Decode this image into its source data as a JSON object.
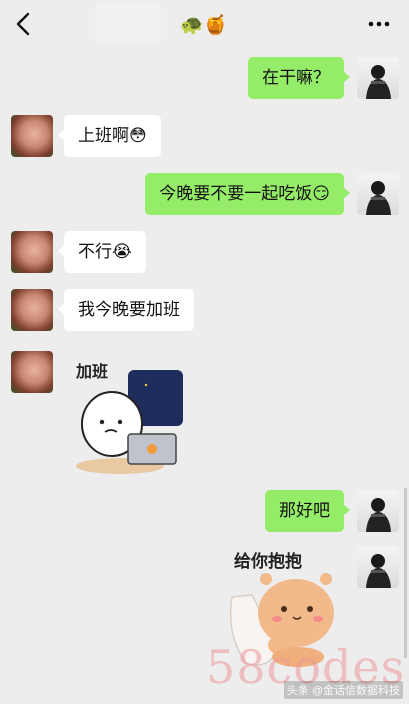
{
  "header": {
    "back_icon": "chevron-left-icon",
    "title_emoji": "🐢🍯",
    "more_icon": "more-dots-icon"
  },
  "messages": [
    {
      "side": "right",
      "type": "text",
      "text": "在干嘛？"
    },
    {
      "side": "left",
      "type": "text",
      "text": "上班啊",
      "emoji": "😳"
    },
    {
      "side": "right",
      "type": "text",
      "text": "今晚要不要一起吃饭",
      "emoji": "😏"
    },
    {
      "side": "left",
      "type": "text",
      "text": "不行",
      "emoji": "😭"
    },
    {
      "side": "left",
      "type": "text",
      "text": "我今晚要加班"
    },
    {
      "side": "left",
      "type": "sticker",
      "sticker_text": "加班"
    },
    {
      "side": "right",
      "type": "text",
      "text": "那好吧"
    },
    {
      "side": "right",
      "type": "sticker",
      "sticker_text": "给你抱抱"
    }
  ],
  "watermark": "58codes",
  "credit": "头条 @金话信数据科技",
  "colors": {
    "background": "#ededed",
    "bubble_self": "#95ec69",
    "bubble_other": "#ffffff"
  }
}
